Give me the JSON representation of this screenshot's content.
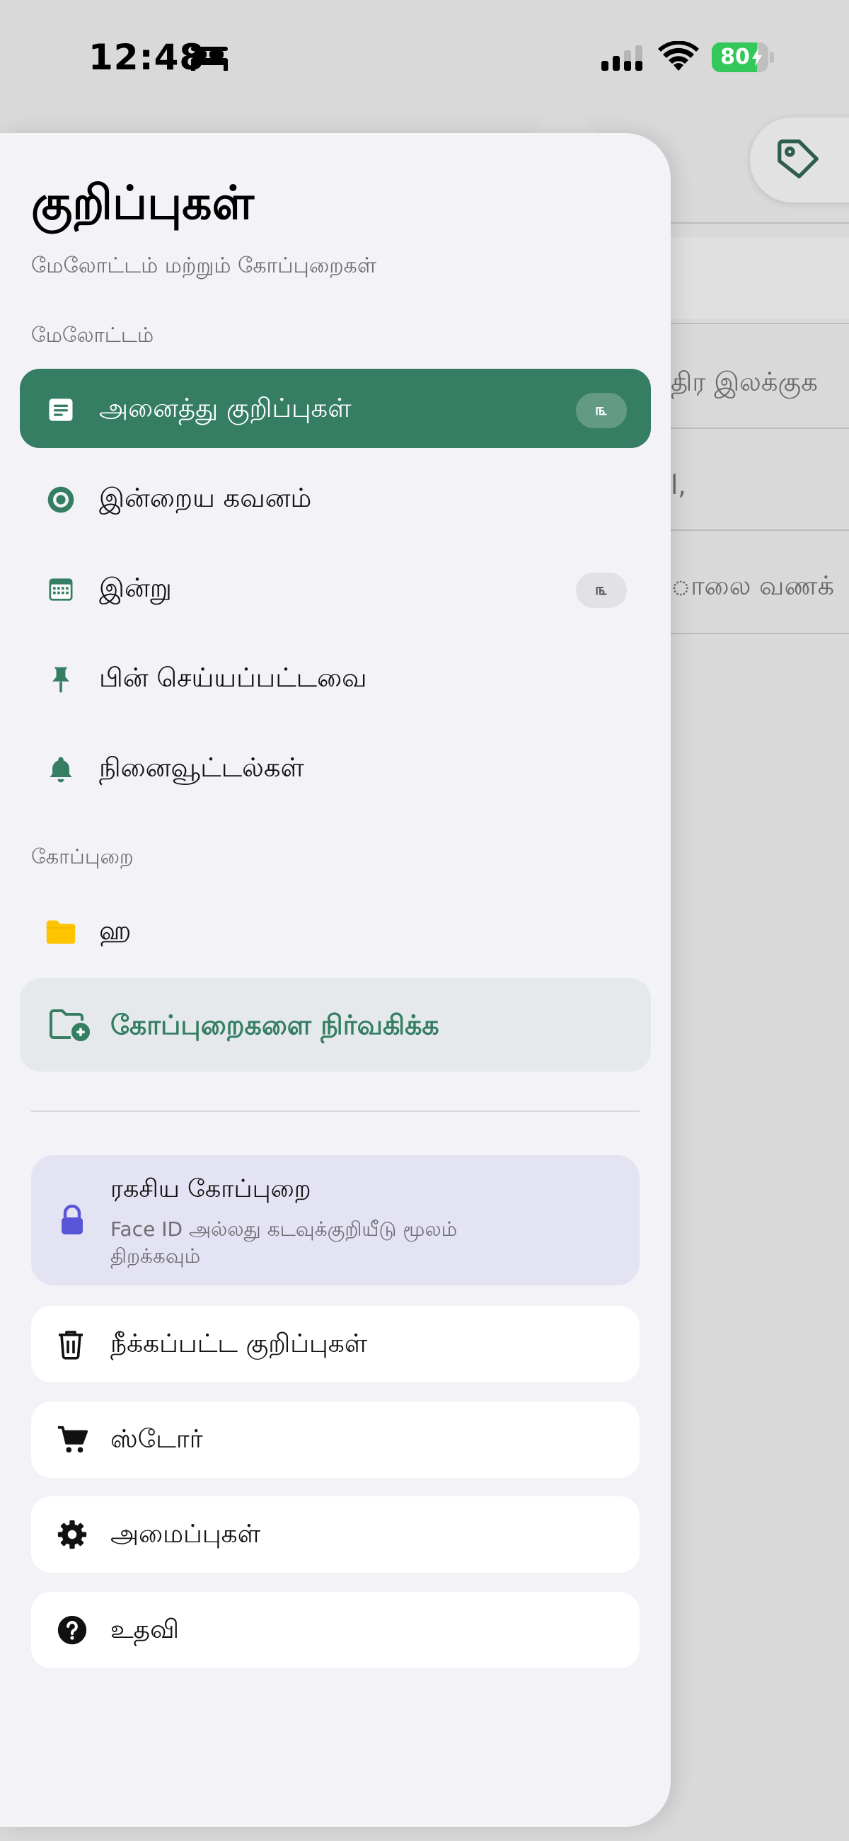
{
  "status_bar": {
    "time": "12:48",
    "battery_level": "80",
    "battery_fraction": 0.8
  },
  "colors": {
    "accent": "#367e63",
    "drawer_bg": "#f2f2f7",
    "secret_card_bg": "#e4e3f3",
    "folder_yellow": "#ffc400",
    "lock_blue": "#5856d6"
  },
  "background": {
    "lines": [
      "திர இலக்குக",
      "l,",
      "ாலை வணக்"
    ]
  },
  "drawer": {
    "title": "குறிப்புகள்",
    "subtitle": "மேலோட்டம் மற்றும் கோப்புறைகள்",
    "overview_label": "மேலோட்டம்",
    "items": [
      {
        "label": "அனைத்து குறிப்புகள்",
        "icon": "notes-icon",
        "badge": "௩",
        "active": true
      },
      {
        "label": "இன்றைய கவனம்",
        "icon": "focus-icon",
        "active": false
      },
      {
        "label": "இன்று",
        "icon": "calendar-icon",
        "badge": "௩",
        "active": false
      },
      {
        "label": "பின் செய்யப்பட்டவை",
        "icon": "pin-icon",
        "active": false
      },
      {
        "label": "நினைவூட்டல்கள்",
        "icon": "bell-icon",
        "active": false
      }
    ],
    "folders_label": "கோப்புறை",
    "folders": [
      {
        "label": "ஹ",
        "icon": "folder-icon"
      }
    ],
    "manage_folders": "கோப்புறைகளை நிர்வகிக்க",
    "secret_folder": {
      "title": "ரகசிய கோப்புறை",
      "subtitle": "Face ID அல்லது கடவுக்குறியீடு மூலம் திறக்கவும்"
    },
    "bottom_items": [
      {
        "label": "நீக்கப்பட்ட குறிப்புகள்",
        "icon": "trash-icon"
      },
      {
        "label": "ஸ்டோர்",
        "icon": "cart-icon"
      },
      {
        "label": "அமைப்புகள்",
        "icon": "gear-icon"
      },
      {
        "label": "உதவி",
        "icon": "help-icon"
      }
    ]
  }
}
